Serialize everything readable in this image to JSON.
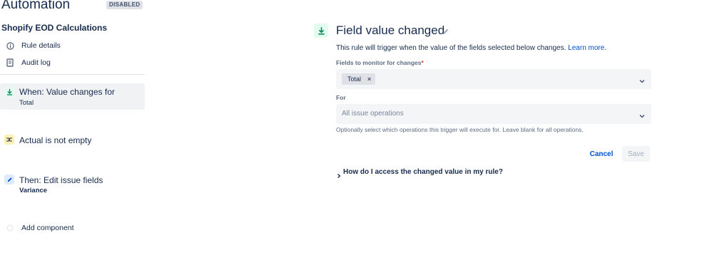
{
  "sidebar": {
    "app_title": "Automation",
    "status_badge": "DISABLED",
    "rule_name": "Shopify EOD Calculations",
    "nav": [
      {
        "label": "Rule details",
        "icon": "info-icon"
      },
      {
        "label": "Audit log",
        "icon": "document-icon"
      }
    ],
    "components": [
      {
        "title": "When: Value changes for",
        "subtitle": "Total",
        "icon": "trigger-icon",
        "color": "#00875a"
      },
      {
        "title": "Actual is not empty",
        "subtitle": "",
        "icon": "condition-icon",
        "color": "#ff8b00"
      },
      {
        "title": "Then: Edit issue fields",
        "subtitle": "Variance",
        "icon": "pencil-icon",
        "color": "#0052cc"
      }
    ],
    "add_component": "Add component"
  },
  "panel": {
    "title": "Field value changed",
    "description": "This rule will trigger when the value of the fields selected below changes.",
    "learn_more": "Learn more.",
    "fields_label": "Fields to monitor for changes",
    "required_mark": "*",
    "selected_field": "Total",
    "chip_remove": "×",
    "for_label": "For",
    "for_placeholder": "All issue operations",
    "help_text": "Optionally select which operations this trigger will execute for. Leave blank for all operations.",
    "cancel": "Cancel",
    "save": "Save",
    "faq": "How do I access the changed value in my rule?"
  },
  "colors": {
    "accent": "#0052cc",
    "trigger": "#00875a",
    "condition": "#ff8b00",
    "selected_bg": "#f1f2f4"
  }
}
